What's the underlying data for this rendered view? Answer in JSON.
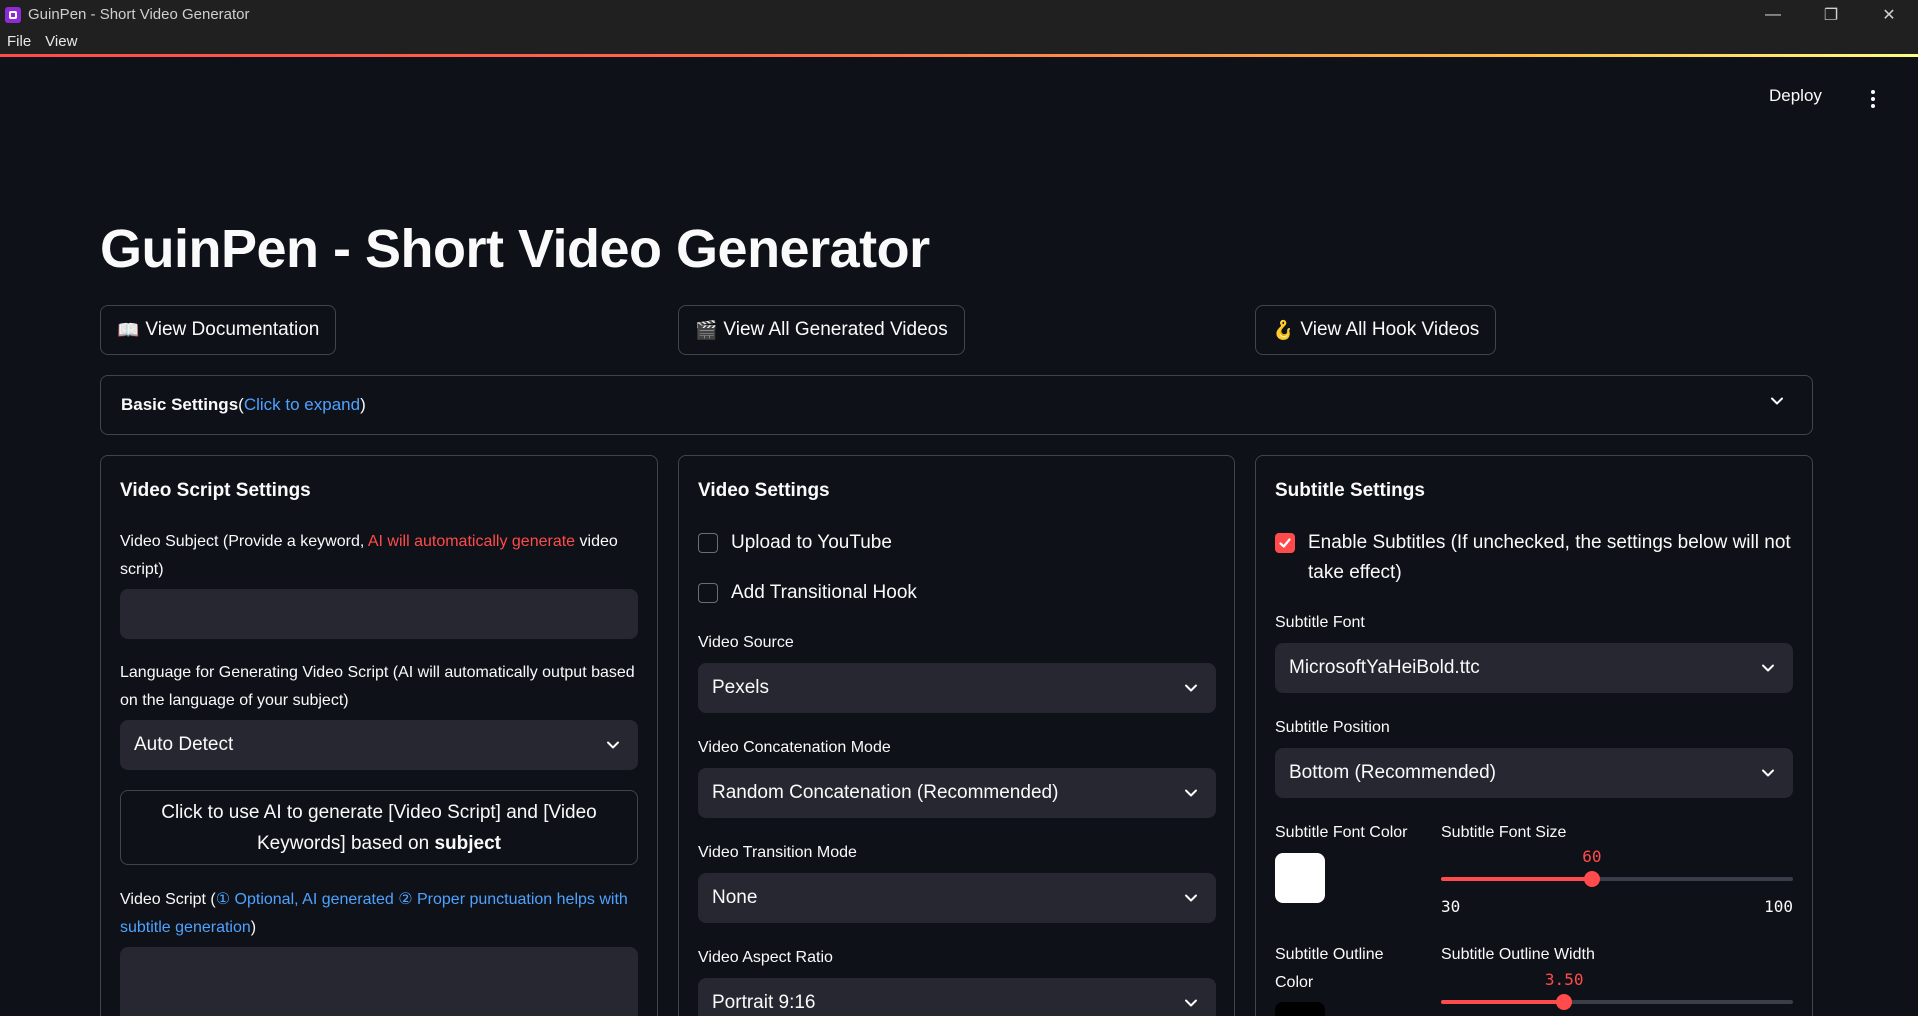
{
  "window": {
    "title": "GuinPen - Short Video Generator",
    "minimize_glyph": "—",
    "restore_glyph": "❐",
    "close_glyph": "✕"
  },
  "menu": [
    "File",
    "View"
  ],
  "toolbar": {
    "deploy_label": "Deploy"
  },
  "page_title": "GuinPen - Short Video Generator",
  "links": [
    {
      "icon": "📖",
      "label": "View Documentation"
    },
    {
      "icon": "🎬",
      "label": "View All Generated Videos"
    },
    {
      "icon": "🪝",
      "label": "View All Hook Videos"
    }
  ],
  "basic_settings": {
    "title": "Basic Settings",
    "open_paren": " (",
    "hint": "Click to expand",
    "close_paren": ")"
  },
  "script_panel": {
    "title": "Video Script Settings",
    "subject_label_pre": "Video Subject (Provide a keyword, ",
    "subject_label_highlight": "AI will automatically generate",
    "subject_label_post": " video script)",
    "subject_value": "",
    "language_label": "Language for Generating Video Script (AI will automatically output based on the language of your subject)",
    "language_value": "Auto Detect",
    "ai_button_pre": "Click to use AI to generate [Video Script] and [Video Keywords] based on ",
    "ai_button_bold": "subject",
    "script_label_pre": "Video Script (",
    "script_label_highlight": "① Optional, AI generated ② Proper punctuation helps with subtitle generation",
    "script_label_post": ")",
    "script_value": ""
  },
  "video_panel": {
    "title": "Video Settings",
    "upload_youtube_label": "Upload to YouTube",
    "upload_youtube_checked": false,
    "transitional_hook_label": "Add Transitional Hook",
    "transitional_hook_checked": false,
    "source_label": "Video Source",
    "source_value": "Pexels",
    "concat_label": "Video Concatenation Mode",
    "concat_value": "Random Concatenation (Recommended)",
    "transition_label": "Video Transition Mode",
    "transition_value": "None",
    "aspect_label": "Video Aspect Ratio",
    "aspect_value": "Portrait 9:16"
  },
  "subtitle_panel": {
    "title": "Subtitle Settings",
    "enable_label": "Enable Subtitles (If unchecked, the settings below will not take effect)",
    "enable_checked": true,
    "font_label": "Subtitle Font",
    "font_value": "MicrosoftYaHeiBold.ttc",
    "position_label": "Subtitle Position",
    "position_value": "Bottom (Recommended)",
    "font_color_label": "Subtitle Font Color",
    "font_color": "#ffffff",
    "font_size_label": "Subtitle Font Size",
    "font_size": {
      "value": 60,
      "display": "60",
      "min": 30,
      "max": 100,
      "min_label": "30",
      "max_label": "100"
    },
    "outline_color_label": "Subtitle Outline Color",
    "outline_color": "#000000",
    "outline_width_label": "Subtitle Outline Width",
    "outline_width": {
      "value": 3.5,
      "display": "3.50",
      "min": 0,
      "max": 10
    }
  },
  "colors": {
    "accent": "#ff4b4b",
    "link": "#4ea2ff",
    "background": "#0e1117",
    "input": "#262730"
  }
}
